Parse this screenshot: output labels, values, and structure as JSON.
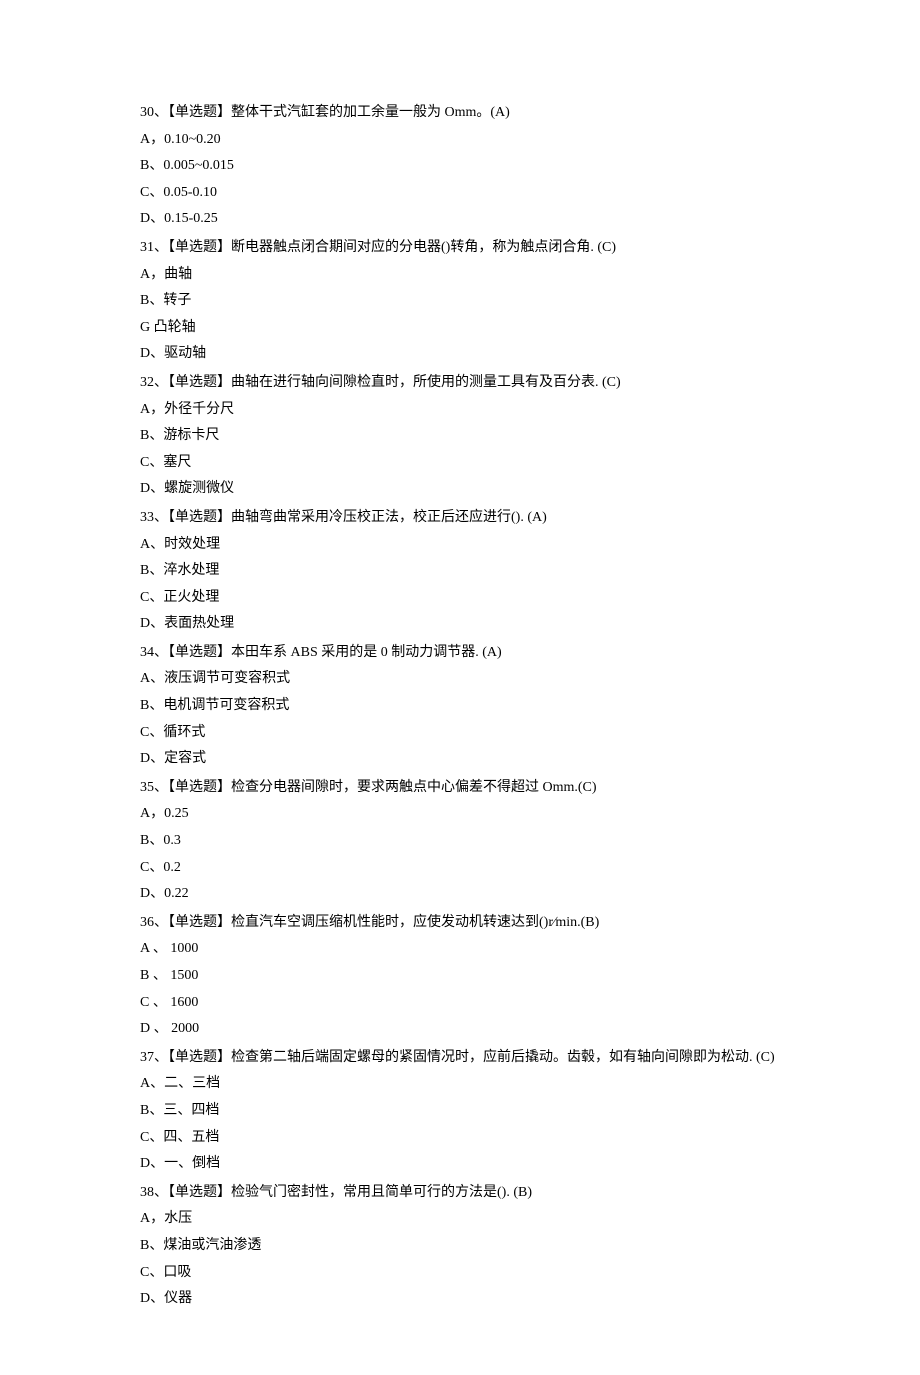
{
  "questions": [
    {
      "number": "30",
      "type": "【单选题】",
      "text": "整体干式汽缸套的加工余量一般为 Omm。(A)",
      "options": [
        {
          "label": "A",
          "sep": "，",
          "text": "0.10~0.20"
        },
        {
          "label": "B",
          "sep": "、",
          "text": "0.005~0.015"
        },
        {
          "label": "C",
          "sep": "、",
          "text": "0.05-0.10"
        },
        {
          "label": "D",
          "sep": "、",
          "text": "0.15-0.25"
        }
      ]
    },
    {
      "number": "31",
      "type": "【单选题】",
      "text": "断电器触点闭合期间对应的分电器()转角，称为触点闭合角. (C)",
      "options": [
        {
          "label": "A",
          "sep": "，",
          "text": "曲轴"
        },
        {
          "label": "B",
          "sep": "、",
          "text": "转子"
        },
        {
          "label": "G",
          "sep": " ",
          "text": "凸轮轴"
        },
        {
          "label": "D",
          "sep": "、",
          "text": "驱动轴"
        }
      ]
    },
    {
      "number": "32",
      "type": "【单选题】",
      "text": "曲轴在进行轴向间隙检直时，所使用的测量工具有及百分表. (C)",
      "options": [
        {
          "label": "A",
          "sep": "，",
          "text": "外径千分尺"
        },
        {
          "label": "B",
          "sep": "、",
          "text": "游标卡尺"
        },
        {
          "label": "C",
          "sep": "、",
          "text": "塞尺"
        },
        {
          "label": "D",
          "sep": "、",
          "text": "螺旋测微仪"
        }
      ]
    },
    {
      "number": "33",
      "type": "【单选题】",
      "text": "曲轴弯曲常采用冷压校正法，校正后还应进行(). (A)",
      "options": [
        {
          "label": "A",
          "sep": "、",
          "text": "时效处理"
        },
        {
          "label": "B",
          "sep": "、",
          "text": "淬水处理"
        },
        {
          "label": "C",
          "sep": "、",
          "text": "正火处理"
        },
        {
          "label": "D",
          "sep": "、",
          "text": "表面热处理"
        }
      ]
    },
    {
      "number": "34",
      "type": "【单选题】",
      "text": "本田车系 ABS 采用的是 0 制动力调节器. (A)",
      "options": [
        {
          "label": "A",
          "sep": "、",
          "text": "液压调节可变容积式"
        },
        {
          "label": "B",
          "sep": "、",
          "text": "电机调节可变容积式"
        },
        {
          "label": "C",
          "sep": "、",
          "text": "循环式"
        },
        {
          "label": "D",
          "sep": "、",
          "text": "定容式"
        }
      ]
    },
    {
      "number": "35",
      "type": "【单选题】",
      "text": "检查分电器间隙时，要求两触点中心偏差不得超过 Omm.(C)",
      "options": [
        {
          "label": "A",
          "sep": "，",
          "text": "0.25"
        },
        {
          "label": "B",
          "sep": "、",
          "text": "0.3"
        },
        {
          "label": "C",
          "sep": "、",
          "text": "0.2"
        },
        {
          "label": "D",
          "sep": "、",
          "text": "0.22"
        }
      ]
    },
    {
      "number": "36",
      "type": "【单选题】",
      "text": "检直汽车空调压缩机性能时，应使发动机转速达到()r∕min.(B)",
      "options": [
        {
          "label": "A",
          "sep": " 、  ",
          "text": "1000"
        },
        {
          "label": "B",
          "sep": " 、  ",
          "text": "1500"
        },
        {
          "label": "C",
          "sep": " 、  ",
          "text": "1600"
        },
        {
          "label": "D",
          "sep": " 、  ",
          "text": "2000"
        }
      ]
    },
    {
      "number": "37",
      "type": "【单选题】",
      "text": "检查第二轴后端固定螺母的紧固情况时，应前后撬动。齿毂，如有轴向间隙即为松动. (C)",
      "options": [
        {
          "label": "A",
          "sep": "、",
          "text": "二、三档"
        },
        {
          "label": "B",
          "sep": "、",
          "text": "三、四档"
        },
        {
          "label": "C",
          "sep": "、",
          "text": "四、五档"
        },
        {
          "label": "D",
          "sep": "、",
          "text": "一、倒档"
        }
      ]
    },
    {
      "number": "38",
      "type": "【单选题】",
      "text": "检验气门密封性，常用且简单可行的方法是(). (B)",
      "options": [
        {
          "label": "A",
          "sep": "，",
          "text": "水压"
        },
        {
          "label": "B",
          "sep": "、",
          "text": "煤油或汽油渗透"
        },
        {
          "label": "C",
          "sep": "、",
          "text": "口吸"
        },
        {
          "label": "D",
          "sep": "、",
          "text": "仪器"
        }
      ]
    }
  ]
}
